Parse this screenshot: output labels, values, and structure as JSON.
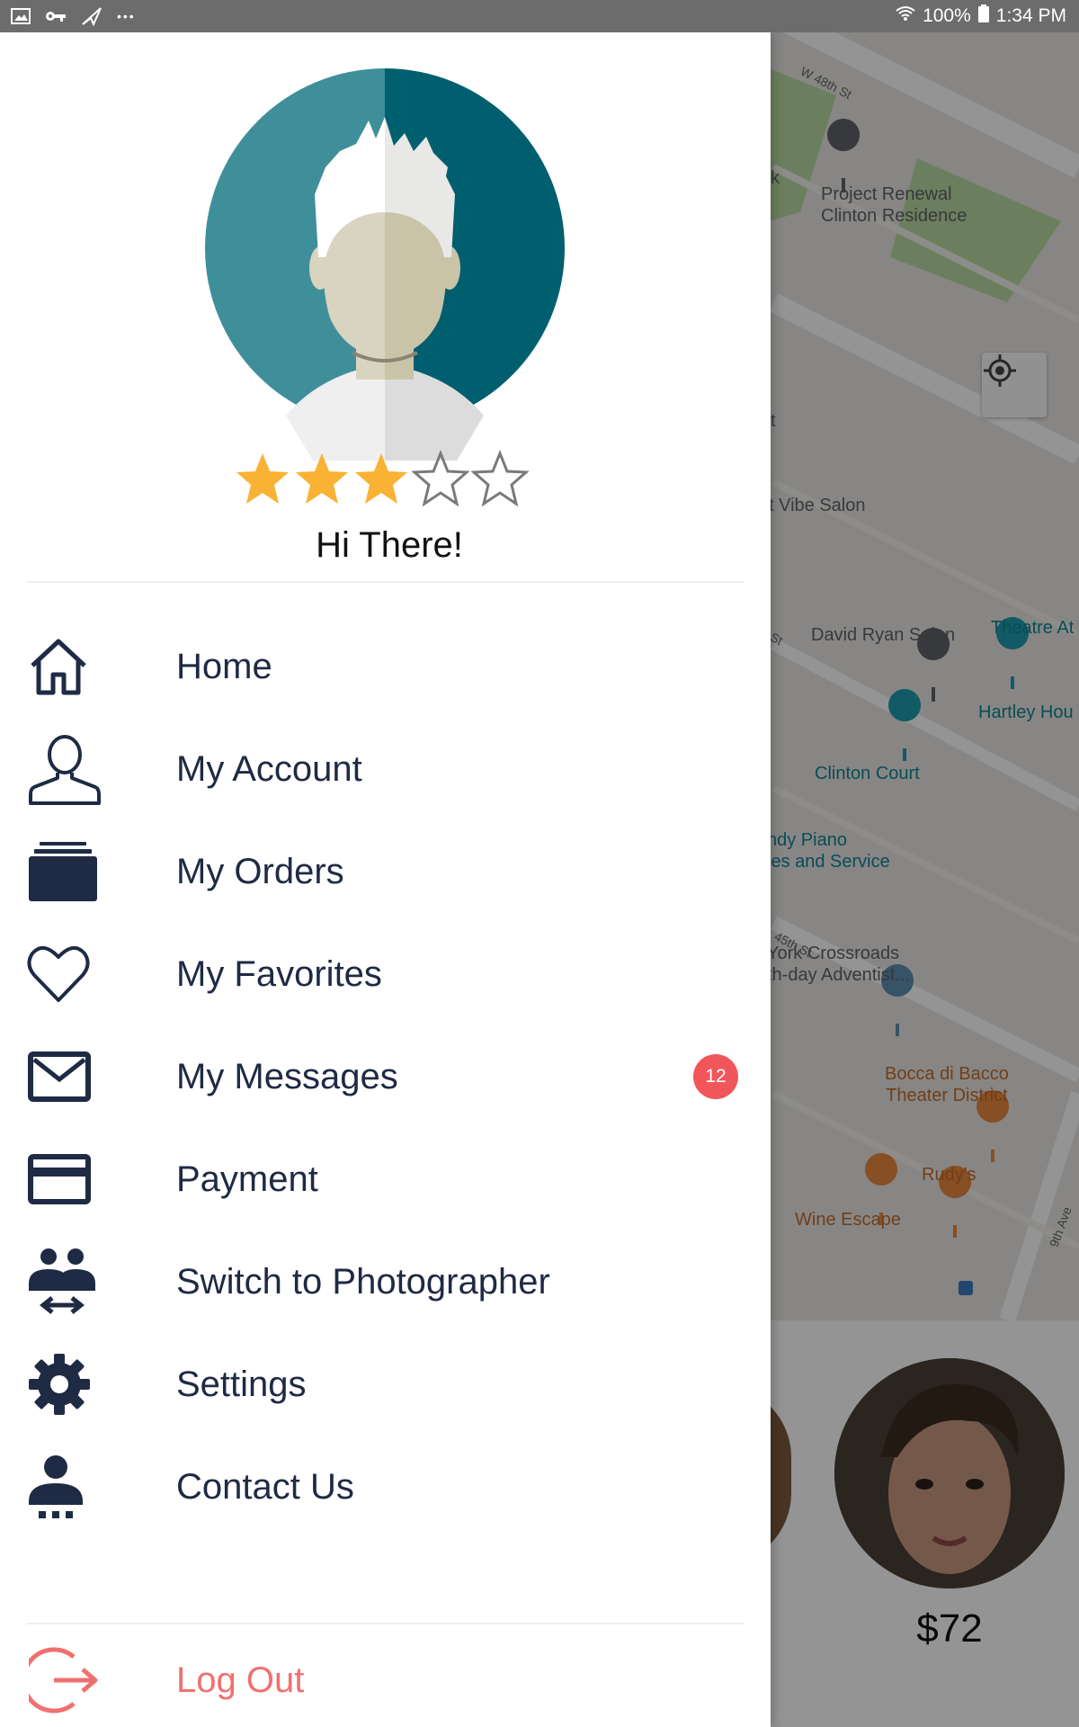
{
  "status_bar": {
    "icons": [
      "image-icon",
      "key-icon",
      "send-icon",
      "more-dots-icon"
    ],
    "more_glyph": "•••",
    "battery": "100%",
    "time": "1:34 PM"
  },
  "map": {
    "streets": [
      "W 48th St",
      "45th St",
      "9th Ave"
    ],
    "places": {
      "project_renewal": "Project Renewal\nClinton Residence",
      "vibe_salon": "t Vibe Salon",
      "david_ryan": "David Ryan Salon",
      "theatre": "Theatre At",
      "hartley": "Hartley Hou",
      "clinton_court": "Clinton Court",
      "piano": "ndy Piano\nles and Service",
      "crossroads": "York Crossroads\nth-day Adventist...",
      "bocca": "Bocca di Bacco\nTheater District",
      "rudys": "Rudy's",
      "wine_escape": "Wine Escape",
      "k_fragment": "k",
      "t_fragment": "t",
      "st_fragment": "St"
    }
  },
  "photographer": {
    "price": "$72"
  },
  "profile": {
    "rating": 3,
    "max_rating": 5,
    "greeting": "Hi There!"
  },
  "colors": {
    "navy": "#1f2a44",
    "star": "#f9b233",
    "badge": "#f1565b",
    "logout": "#f07070",
    "avatar_left": "#3f8f9b",
    "avatar_right": "#005f6e"
  },
  "menu": [
    {
      "label": "Home",
      "icon": "home-icon"
    },
    {
      "label": "My Account",
      "icon": "user-icon"
    },
    {
      "label": "My Orders",
      "icon": "orders-stack-icon"
    },
    {
      "label": "My Favorites",
      "icon": "heart-icon"
    },
    {
      "label": "My Messages",
      "icon": "envelope-icon",
      "badge": "12"
    },
    {
      "label": "Payment",
      "icon": "credit-card-icon"
    },
    {
      "label": "Switch to Photographer",
      "icon": "switch-users-icon"
    },
    {
      "label": "Settings",
      "icon": "gear-icon"
    },
    {
      "label": "Contact Us",
      "icon": "support-agent-icon"
    }
  ],
  "logout": {
    "label": "Log Out",
    "icon": "logout-icon"
  }
}
